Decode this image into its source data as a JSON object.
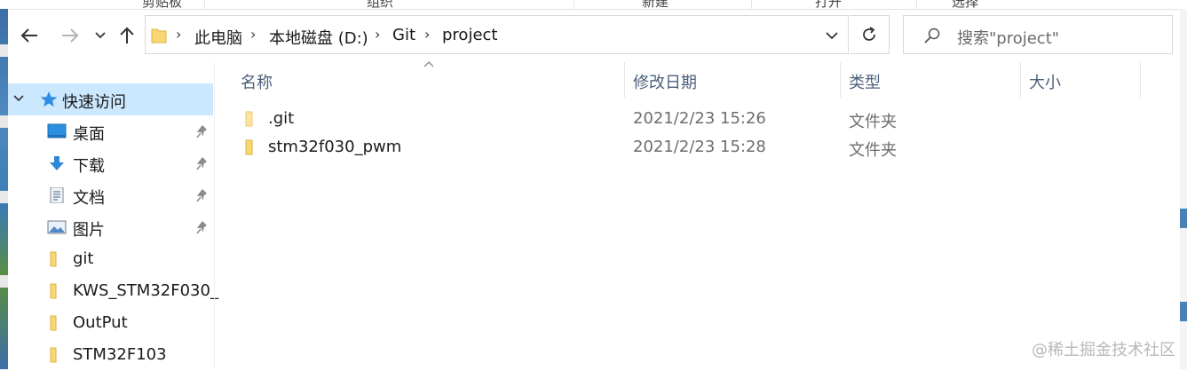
{
  "ribbon": {
    "groups": [
      "剪贴板",
      "组织",
      "新建",
      "打开",
      "选择"
    ]
  },
  "nav": {
    "back_icon": "arrow-left-icon",
    "forward_icon": "arrow-right-icon",
    "recent_icon": "chevron-down-icon",
    "up_icon": "arrow-up-icon"
  },
  "address": {
    "crumbs": [
      "此电脑",
      "本地磁盘 (D:)",
      "Git",
      "project"
    ],
    "separator": "›"
  },
  "search": {
    "placeholder": "搜索\"project\""
  },
  "sidebar": {
    "quick_access": "快速访问",
    "items": [
      {
        "label": "桌面",
        "icon": "desktop-icon",
        "pinned": true
      },
      {
        "label": "下载",
        "icon": "download-icon",
        "pinned": true
      },
      {
        "label": "文档",
        "icon": "document-icon",
        "pinned": true
      },
      {
        "label": "图片",
        "icon": "picture-icon",
        "pinned": true
      },
      {
        "label": "git",
        "icon": "folder-icon",
        "pinned": false
      },
      {
        "label": "KWS_STM32F030_",
        "icon": "folder-icon",
        "pinned": false
      },
      {
        "label": "OutPut",
        "icon": "folder-icon",
        "pinned": false
      },
      {
        "label": "STM32F103",
        "icon": "folder-icon",
        "pinned": false
      }
    ]
  },
  "columns": {
    "name": "名称",
    "modified": "修改日期",
    "type": "类型",
    "size": "大小"
  },
  "files": [
    {
      "name": ".git",
      "modified": "2021/2/23 15:26",
      "type": "文件夹"
    },
    {
      "name": "stm32f030_pwm",
      "modified": "2021/2/23 15:28",
      "type": "文件夹"
    }
  ],
  "watermark": "@稀土掘金技术社区",
  "colors": {
    "selection": "#cce8ff",
    "folder": "#f8d775",
    "header_text": "#4c607a",
    "quick_access_star": "#2f8ee0"
  }
}
